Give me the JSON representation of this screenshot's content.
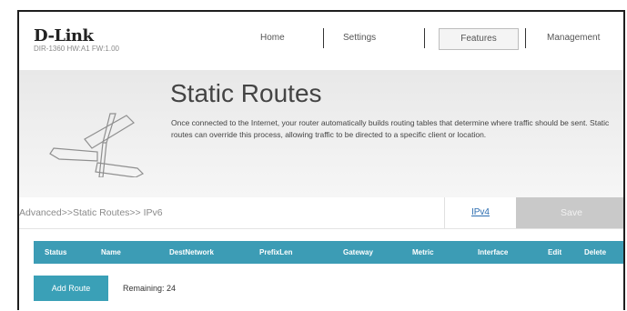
{
  "brand": {
    "logo": "D-Link",
    "firmware": "DIR-1360 HW:A1 FW:1.00"
  },
  "nav": {
    "home": "Home",
    "settings": "Settings",
    "features": "Features",
    "management": "Management"
  },
  "banner": {
    "title": "Static Routes",
    "description": "Once connected to the Internet, your router automatically builds routing tables that determine where traffic should be sent. Static routes can override this process, allowing traffic to be directed to a specific client or location."
  },
  "breadcrumb": "Advanced>>Static Routes>> IPv6",
  "actions": {
    "ipv4": "IPv4",
    "save": "Save"
  },
  "table": {
    "columns": [
      "Status",
      "Name",
      "DestNetwork",
      "PrefixLen",
      "Gateway",
      "Metric",
      "Interface",
      "Edit",
      "Delete"
    ]
  },
  "add_route": "Add Route",
  "remaining": "Remaining: 24",
  "colors": {
    "accent": "#3c9cb5",
    "save_disabled": "#c9c9c9",
    "link": "#2b6cb0"
  }
}
